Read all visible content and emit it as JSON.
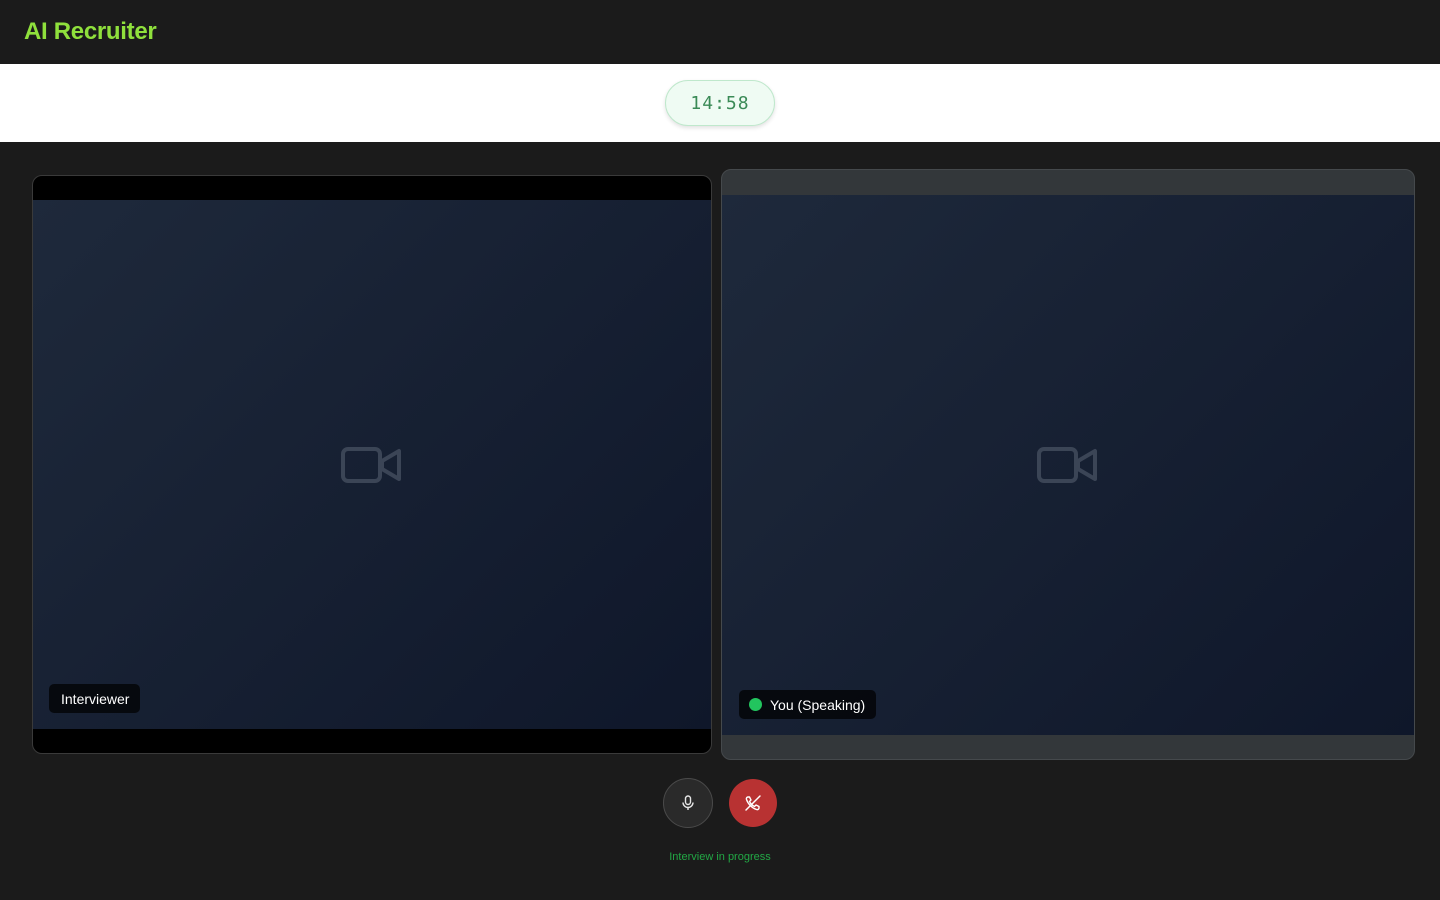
{
  "header": {
    "brand": "AI Recruiter"
  },
  "timer": {
    "value": "14:58"
  },
  "tiles": {
    "interviewer": {
      "label": "Interviewer",
      "icon": "video-camera-icon"
    },
    "candidate": {
      "label": "You (Speaking)",
      "speaking": true,
      "icon": "video-camera-icon"
    }
  },
  "controls": {
    "mic": {
      "icon": "microphone-icon"
    },
    "end": {
      "icon": "phone-off-icon"
    }
  },
  "status": {
    "text": "Interview in progress"
  },
  "colors": {
    "brand": "#8fe03c",
    "speaking": "#22c55e",
    "end_call": "#b83232",
    "status": "#22a845"
  }
}
